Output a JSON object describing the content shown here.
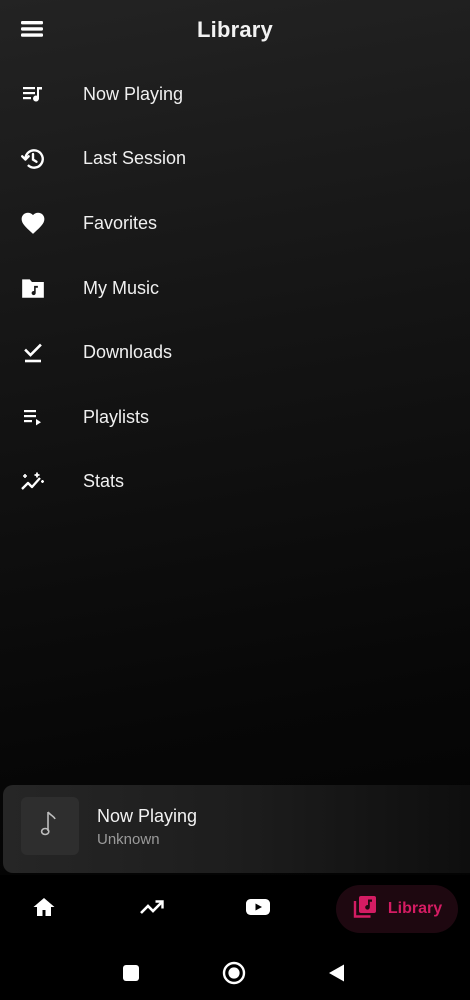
{
  "header": {
    "title": "Library",
    "menu_icon": "hamburger-menu-icon"
  },
  "menu": {
    "items": [
      {
        "label": "Now Playing",
        "icon": "queue-music-icon"
      },
      {
        "label": "Last Session",
        "icon": "history-icon"
      },
      {
        "label": "Favorites",
        "icon": "heart-icon"
      },
      {
        "label": "My Music",
        "icon": "music-folder-icon"
      },
      {
        "label": "Downloads",
        "icon": "download-done-icon"
      },
      {
        "label": "Playlists",
        "icon": "playlist-play-icon"
      },
      {
        "label": "Stats",
        "icon": "insights-icon"
      }
    ]
  },
  "mini_player": {
    "title": "Now Playing",
    "subtitle": "Unknown",
    "art_icon": "music-note-icon"
  },
  "bottom_nav": {
    "items": [
      {
        "name": "home",
        "icon": "home-icon"
      },
      {
        "name": "trending",
        "icon": "trending-up-icon"
      },
      {
        "name": "youtube",
        "icon": "youtube-icon"
      },
      {
        "name": "library",
        "icon": "library-music-icon",
        "label": "Library",
        "active": true
      }
    ],
    "accent_color": "#d41c63"
  },
  "system_nav": {
    "icons": [
      "recents-square-icon",
      "home-circle-icon",
      "back-triangle-icon"
    ]
  }
}
